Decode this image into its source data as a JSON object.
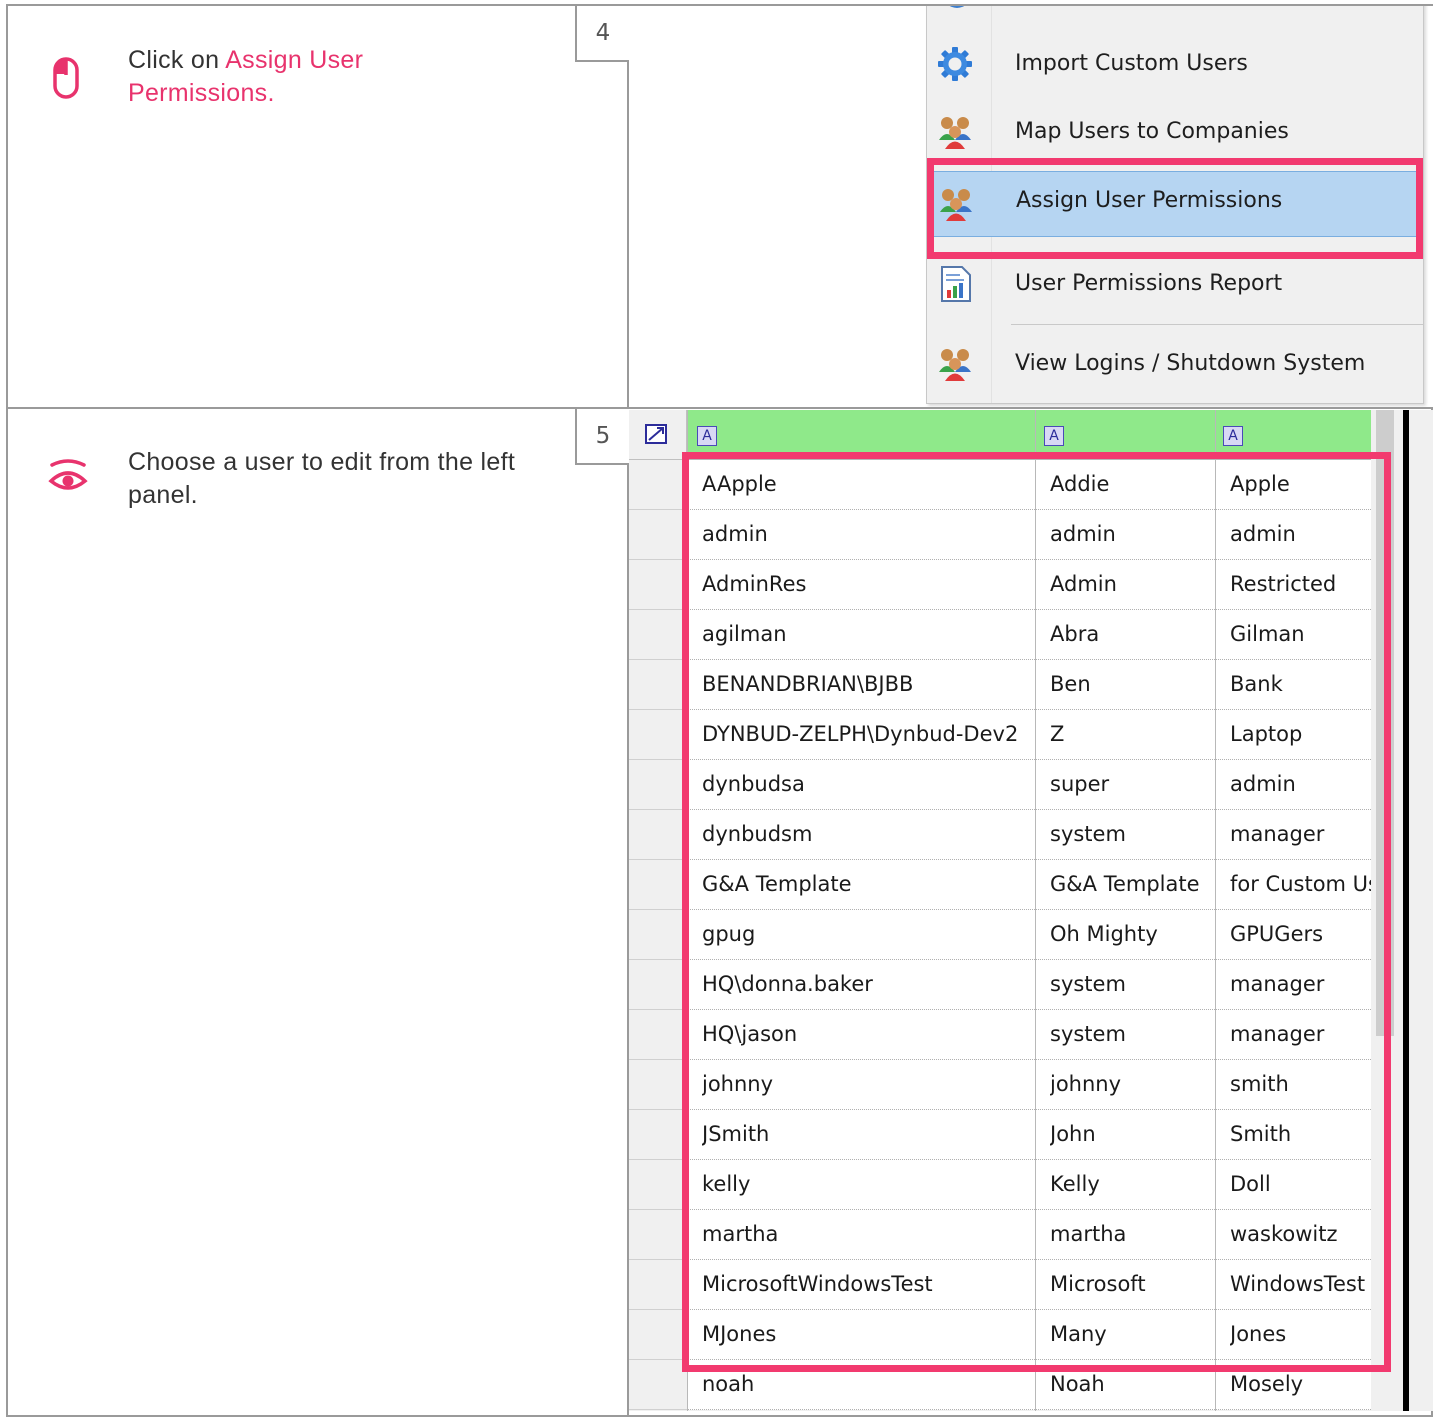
{
  "steps": [
    {
      "number": "4",
      "text_prefix": "Click on ",
      "text_link": "Assign User Permissions.",
      "icon": "mouse-icon"
    },
    {
      "number": "5",
      "text": "Choose a user to edit from the left panel.",
      "icon": "eye-icon"
    }
  ],
  "menu": {
    "items": [
      {
        "label": "Import Custom Users",
        "icon": "gear-icon"
      },
      {
        "label": "Map Users to Companies",
        "icon": "users-icon"
      },
      {
        "label": "Assign User Permissions",
        "icon": "users-icon",
        "selected": true
      },
      {
        "label": "User Permissions Report",
        "icon": "report-icon"
      },
      {
        "label": "View Logins / Shutdown System",
        "icon": "users-icon"
      }
    ]
  },
  "grid": {
    "header_buttons": [
      "A",
      "A",
      "A"
    ],
    "rows": [
      [
        "AApple",
        "Addie",
        "Apple"
      ],
      [
        "admin",
        "admin",
        "admin"
      ],
      [
        "AdminRes",
        "Admin",
        "Restricted"
      ],
      [
        "agilman",
        "Abra",
        "Gilman"
      ],
      [
        "BENANDBRIAN\\BJBB",
        "Ben",
        "Bank"
      ],
      [
        "DYNBUD-ZELPH\\Dynbud-Dev2",
        "Z",
        "Laptop"
      ],
      [
        "dynbudsa",
        "super",
        "admin"
      ],
      [
        "dynbudsm",
        "system",
        "manager"
      ],
      [
        "G&A Template",
        "G&A Template",
        "for Custom Us"
      ],
      [
        "gpug",
        "Oh Mighty",
        "GPUGers"
      ],
      [
        "HQ\\donna.baker",
        "system",
        "manager"
      ],
      [
        "HQ\\jason",
        "system",
        "manager"
      ],
      [
        "johnny",
        "johnny",
        "smith"
      ],
      [
        "JSmith",
        "John",
        "Smith"
      ],
      [
        "kelly",
        "Kelly",
        "Doll"
      ],
      [
        "martha",
        "martha",
        "waskowitz"
      ],
      [
        "MicrosoftWindowsTest",
        "Microsoft",
        "WindowsTest"
      ],
      [
        "MJones",
        "Many",
        "Jones"
      ],
      [
        "noah",
        "Noah",
        "Mosely"
      ]
    ]
  },
  "colors": {
    "accent": "#f23a6f",
    "header_green": "#8fe98a",
    "menu_selected": "#b6d5f2"
  }
}
